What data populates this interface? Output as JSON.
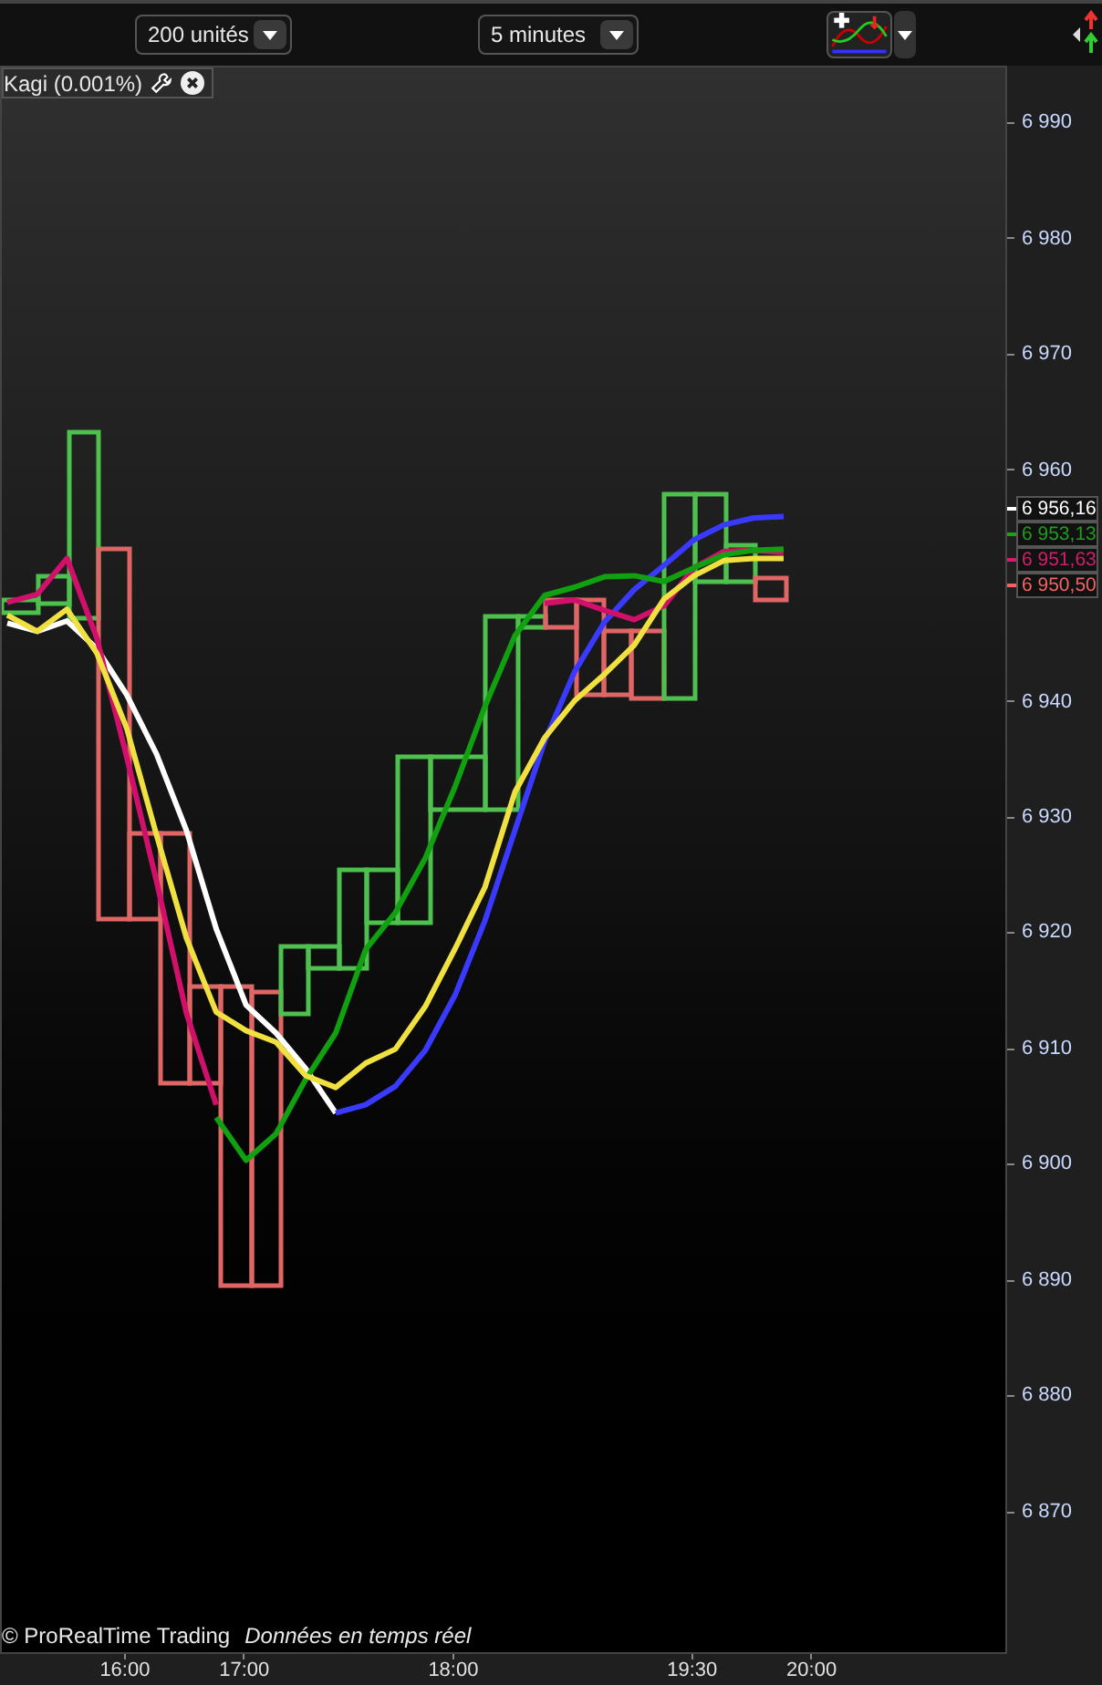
{
  "toolbar": {
    "units_select": {
      "value": "200 unités"
    },
    "interval_select": {
      "value": "5 minutes"
    }
  },
  "chart": {
    "legend": {
      "label": "Kagi (0.001%)"
    },
    "price_tags": [
      {
        "text": "6 956,16",
        "color": "#ffffff"
      },
      {
        "text": "6 953,13",
        "color": "#1e9e1e"
      },
      {
        "text": "6 951,63",
        "color": "#d21e6e"
      },
      {
        "text": "6 950,50",
        "color": "#f06464"
      }
    ],
    "footer": {
      "copyright": "© ProRealTime Trading",
      "status": "Données en temps réel"
    },
    "chart_data": {
      "type": "line",
      "categories": [
        null,
        null,
        null,
        null,
        "16:00",
        null,
        null,
        null,
        "17:00",
        null,
        null,
        null,
        null,
        null,
        null,
        "18:00",
        null,
        null,
        null,
        null,
        null,
        null,
        null,
        "19:30",
        null,
        null,
        null,
        "20:00",
        null,
        null,
        null,
        null,
        null,
        null
      ],
      "ylim": [
        6857.7,
        6994.9
      ],
      "yticks": [
        {
          "value": 6990,
          "label": "6 990"
        },
        {
          "value": 6980,
          "label": "6 980"
        },
        {
          "value": 6970,
          "label": "6 970"
        },
        {
          "value": 6960,
          "label": "6 960"
        },
        {
          "value": 6940,
          "label": "6 940"
        },
        {
          "value": 6930,
          "label": "6 930"
        },
        {
          "value": 6920,
          "label": "6 920"
        },
        {
          "value": 6910,
          "label": "6 910"
        },
        {
          "value": 6900,
          "label": "6 900"
        },
        {
          "value": 6890,
          "label": "6 890"
        },
        {
          "value": 6880,
          "label": "6 880"
        },
        {
          "value": 6870,
          "label": "6 870"
        }
      ],
      "series": [
        {
          "color": "#ffffff",
          "values": [
            6946.9,
            6946.2,
            6947.1,
            6944.7,
            6940.7,
            6935.6,
            6929.0,
            6920.5,
            6913.9,
            6911.5,
            6908.4,
            6904.6,
            null,
            null,
            null,
            null,
            null,
            null,
            null,
            null,
            null,
            null,
            null,
            null,
            null,
            null,
            null,
            null,
            null,
            null,
            null,
            null,
            null,
            null
          ]
        },
        {
          "color": "#3a3aff",
          "values": [
            null,
            null,
            null,
            null,
            null,
            null,
            null,
            null,
            null,
            null,
            null,
            6904.6,
            6905.3,
            6906.9,
            6910.0,
            6914.8,
            6921.2,
            6929.0,
            6936.7,
            6942.7,
            6947.0,
            6949.8,
            6951.9,
            6954.1,
            6955.4,
            6956.0,
            6956.1,
            null,
            null,
            null,
            null,
            null,
            null,
            null
          ]
        },
        {
          "color": "#d0106a",
          "values": [
            6948.7,
            6949.4,
            6952.5,
            6945.6,
            6935.3,
            6924.6,
            6913.2,
            6905.3,
            null,
            null,
            null,
            null,
            null,
            null,
            null,
            null,
            null,
            null,
            6948.6,
            6948.9,
            6948.0,
            6947.2,
            6948.4,
            6951.7,
            6953.1,
            6953.2,
            6953.0,
            null,
            null,
            null,
            null,
            null,
            null,
            null
          ]
        },
        {
          "color": "#10a010",
          "values": [
            null,
            null,
            null,
            null,
            null,
            null,
            null,
            6904.2,
            6900.5,
            6902.8,
            6907.5,
            6911.5,
            6918.7,
            6921.9,
            6926.6,
            6932.8,
            6939.7,
            6945.8,
            6949.3,
            6950.0,
            6950.9,
            6951.0,
            6950.5,
            6951.7,
            6952.8,
            6953.2,
            6953.3,
            null,
            null,
            null,
            null,
            null,
            null,
            null
          ]
        },
        {
          "color": "#f0e040",
          "values": [
            6947.6,
            6946.2,
            6948.1,
            6944.3,
            6937.8,
            6928.6,
            6919.7,
            6913.3,
            6911.7,
            6910.7,
            6907.8,
            6906.8,
            6908.9,
            6910.1,
            6913.8,
            6918.8,
            6924.1,
            6932.3,
            6937.0,
            6940.2,
            6942.5,
            6945.0,
            6949.0,
            6951.0,
            6952.3,
            6952.5,
            6952.5,
            null,
            null,
            null,
            null,
            null,
            null,
            null
          ]
        }
      ]
    }
  }
}
